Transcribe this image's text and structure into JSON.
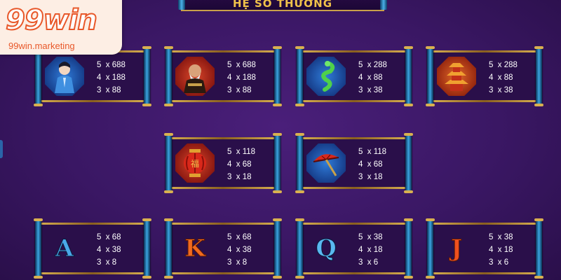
{
  "header": {
    "title": "HỆ SỐ THƯỞNG"
  },
  "watermark": {
    "brand": "99win",
    "site": "99win.marketing"
  },
  "paytable": [
    {
      "symbol": "swordsman-icon",
      "lines": [
        "5  x 688",
        "4  x 188",
        "3  x 88"
      ]
    },
    {
      "symbol": "warrior-icon",
      "lines": [
        "5  x 688",
        "4  x 188",
        "3  x 88"
      ]
    },
    {
      "symbol": "jade-dragon-icon",
      "lines": [
        "5  x 288",
        "4  x 88",
        "3  x 38"
      ]
    },
    {
      "symbol": "pagoda-icon",
      "lines": [
        "5  x 288",
        "4  x 88",
        "3  x 38"
      ]
    },
    {
      "symbol": "lantern-icon",
      "lines": [
        "5  x 118",
        "4  x 68",
        "3  x 18"
      ]
    },
    {
      "symbol": "umbrella-icon",
      "lines": [
        "5  x 118",
        "4  x 68",
        "3  x 18"
      ]
    },
    {
      "symbol": "letter-a-icon",
      "glyph": "A",
      "lines": [
        "5  x 68",
        "4  x 38",
        "3  x 8"
      ]
    },
    {
      "symbol": "letter-k-icon",
      "glyph": "K",
      "lines": [
        "5  x 68",
        "4  x 38",
        "3  x 8"
      ]
    },
    {
      "symbol": "letter-q-icon",
      "glyph": "Q",
      "lines": [
        "5  x 38",
        "4  x 18",
        "3  x 6"
      ]
    },
    {
      "symbol": "letter-j-icon",
      "glyph": "J",
      "lines": [
        "5  x 38",
        "4  x 18",
        "3  x 6"
      ]
    }
  ],
  "colors": {
    "background": "#3a1764",
    "gold": "#d9b050",
    "rod_blue": "#3aa4e0",
    "text": "#ffffff"
  }
}
